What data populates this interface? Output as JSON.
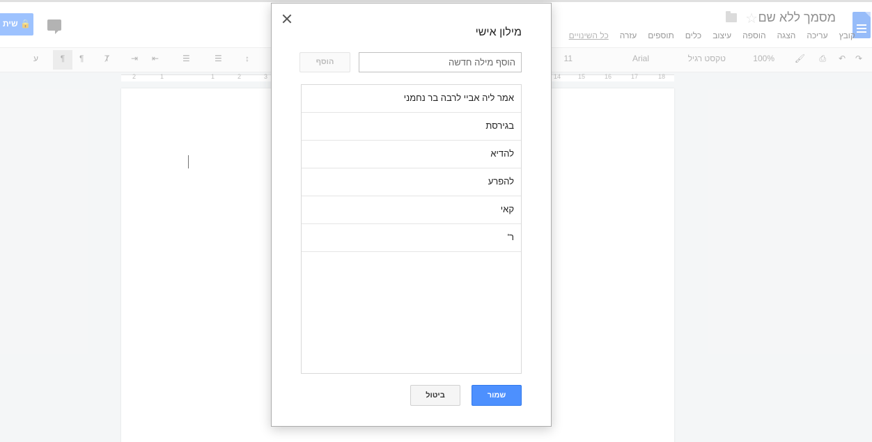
{
  "document": {
    "title": "מסמך ללא שם",
    "menu": [
      "קובץ",
      "עריכה",
      "הצגה",
      "הוספה",
      "עיצוב",
      "כלים",
      "תוספים",
      "עזרה"
    ],
    "all_changes": "כל השינויים",
    "share_label": "שית"
  },
  "toolbar": {
    "zoom": "100%",
    "style": "טקסט רגיל",
    "font": "Arial",
    "size": "11",
    "direction_label": "ע"
  },
  "ruler": {
    "left_labels": [
      "2",
      "1",
      "1",
      "2",
      "3"
    ],
    "right_labels": [
      "14",
      "15",
      "16",
      "17",
      "18"
    ]
  },
  "dialog": {
    "title": "מילון אישי",
    "input_placeholder": "הוסף מילה חדשה",
    "add_label": "הוסף",
    "words": [
      "אמר ליה אביי לרבה בר נחמני",
      "בגירסת",
      "להדיא",
      "להפרע",
      "קאי",
      "ר'"
    ],
    "save_label": "שמור",
    "cancel_label": "ביטול"
  }
}
